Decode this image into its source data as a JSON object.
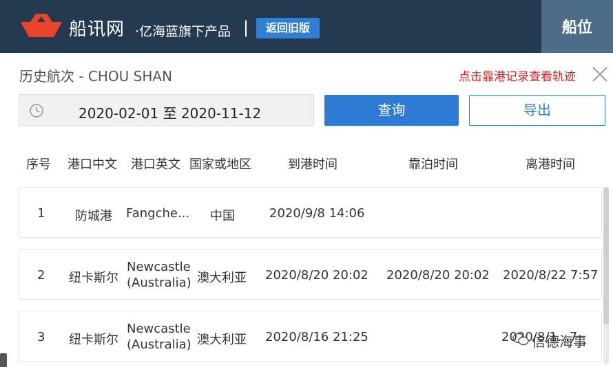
{
  "header": {
    "brand": "船讯网",
    "slogan": "·亿海蓝旗下产品",
    "separator": "|",
    "old_version_button": "返回旧版",
    "berth_tab": "船位"
  },
  "panel": {
    "title": "历史航次 - CHOU SHAN",
    "track_link": "点击靠港记录查看轨迹"
  },
  "filters": {
    "date_range": "2020-02-01 至 2020-11-12",
    "query_button": "查询",
    "export_button": "导出"
  },
  "table": {
    "columns": [
      "序号",
      "港口中文",
      "港口英文",
      "国家或地区",
      "到港时间",
      "靠泊时间",
      "离港时间"
    ],
    "rows": [
      {
        "no": "1",
        "port_cn": "防城港",
        "port_en_1": "Fangche...",
        "port_en_2": "",
        "country": "中国",
        "arrival": "2020/9/8 14:06",
        "berth": "",
        "departure": ""
      },
      {
        "no": "2",
        "port_cn": "纽卡斯尔",
        "port_en_1": "Newcastle",
        "port_en_2": "(Australia)",
        "country": "澳大利亚",
        "arrival": "2020/8/20 20:02",
        "berth": "2020/8/20 20:02",
        "departure": "2020/8/22 7:57"
      },
      {
        "no": "3",
        "port_cn": "纽卡斯尔",
        "port_en_1": "Newcastle",
        "port_en_2": "(Australia)",
        "country": "澳大利亚",
        "arrival": "2020/8/16 21:25",
        "berth": "",
        "departure": "2020/8/1…7"
      }
    ]
  },
  "watermark": "信德海事",
  "colors": {
    "header_bg": "#243a50",
    "accent_blue": "#2e7bd6",
    "link_red": "#e02020",
    "logo_red": "#e8452c"
  }
}
